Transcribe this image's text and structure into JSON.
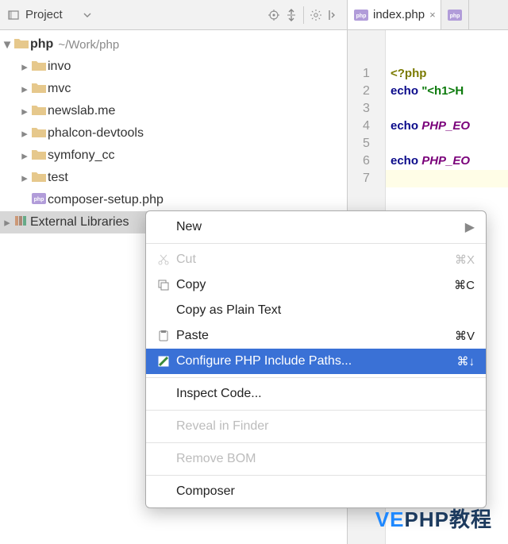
{
  "panel": {
    "title": "Project"
  },
  "tabs": [
    {
      "icon": "php",
      "label": "index.php",
      "active": true
    },
    {
      "icon": "php",
      "label": "",
      "active": false
    }
  ],
  "project": {
    "root": {
      "name": "php",
      "path": "~/Work/php"
    },
    "folders": [
      {
        "name": "invo"
      },
      {
        "name": "mvc"
      },
      {
        "name": "newslab.me"
      },
      {
        "name": "phalcon-devtools"
      },
      {
        "name": "symfony_cc"
      },
      {
        "name": "test"
      }
    ],
    "files": [
      {
        "name": "composer-setup.php",
        "icon": "php"
      }
    ],
    "external": "External Libraries"
  },
  "code": {
    "lines": [
      "1",
      "2",
      "3",
      "4",
      "5",
      "6",
      "7"
    ],
    "l1_tag": "<?php",
    "l2_kw": "echo",
    "l2_str": "\"<h1>H",
    "l4_kw": "echo",
    "l4_c": "PHP_EO",
    "l6_kw": "echo",
    "l6_c": "PHP_EO"
  },
  "menu": {
    "new": "New",
    "cut": {
      "label": "Cut",
      "key": "⌘X"
    },
    "copy": {
      "label": "Copy",
      "key": "⌘C"
    },
    "copy_plain": "Copy as Plain Text",
    "paste": {
      "label": "Paste",
      "key": "⌘V"
    },
    "cfg": {
      "label": "Configure PHP Include Paths...",
      "key": "⌘↓"
    },
    "inspect": "Inspect Code...",
    "reveal": "Reveal in Finder",
    "bom": "Remove BOM",
    "composer": "Composer"
  },
  "watermark": {
    "a": "VE",
    "b": "PHP教程"
  }
}
